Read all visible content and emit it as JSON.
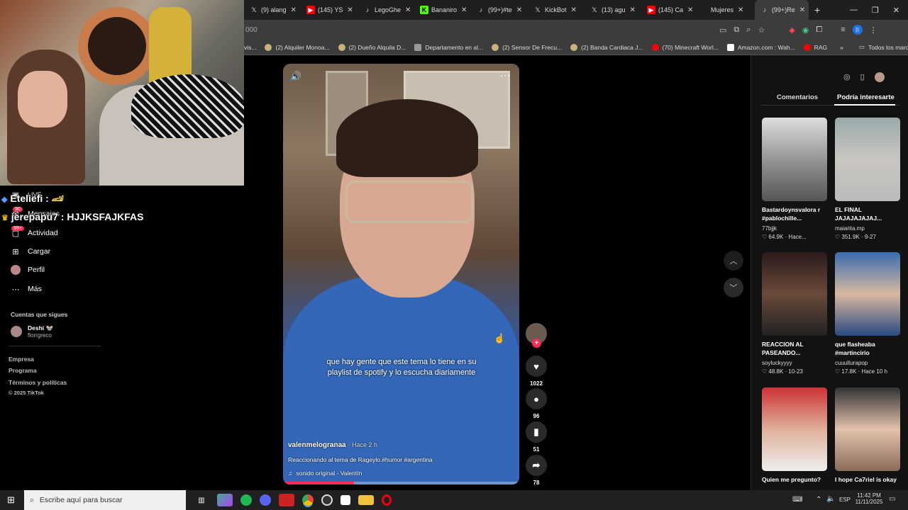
{
  "browser": {
    "tabs": [
      {
        "label": "(9) alang",
        "icon": "x-icon"
      },
      {
        "label": "(145) YS",
        "icon": "youtube-icon"
      },
      {
        "label": "LegoGhe",
        "icon": "tiktok-icon"
      },
      {
        "label": "Bananiro",
        "icon": "kick-icon"
      },
      {
        "label": "(99+)#te",
        "icon": "tiktok-icon"
      },
      {
        "label": "KickBot",
        "icon": "x-icon"
      },
      {
        "label": "(13) agu",
        "icon": "x-icon"
      },
      {
        "label": "(145) Ca",
        "icon": "youtube-icon"
      },
      {
        "label": "Mujeres",
        "icon": "none"
      },
      {
        "label": "(99+)Re",
        "icon": "tiktok-icon",
        "active": true
      }
    ],
    "new_tab": "+",
    "url": "000",
    "bookmarks": [
      "vis...",
      "(2) Alquiler Monoa...",
      "(2) Dueño Alquila D...",
      "Departamento en al...",
      "(2) Sensor De Frecu...",
      "(2) Banda Cardiaca J...",
      "(70) Minecraft Worl...",
      "Amazon.com : Wah...",
      "RAG"
    ],
    "all_bookmarks": "Todos los marcadores"
  },
  "stream_overlay": {
    "chat": [
      {
        "user": "Eteliefi",
        "text": ":"
      },
      {
        "user": "jerepapu7",
        "text": ": HJJKSFAJKFAS"
      }
    ],
    "badges": {
      "live": "LIVE",
      "messages_count": "90",
      "activity_count": "99+"
    }
  },
  "sidebar": {
    "items": [
      {
        "label": "Mensajes"
      },
      {
        "label": "Actividad"
      },
      {
        "label": "Cargar"
      },
      {
        "label": "Perfil"
      },
      {
        "label": "Más"
      }
    ],
    "following_title": "Cuentas que sigues",
    "following": {
      "name": "Deshi 🐭",
      "handle": "florrgreco"
    },
    "footer": [
      "Empresa",
      "Programa",
      "Términos y políticas",
      "© 2025 TikTok"
    ]
  },
  "video": {
    "caption": "que hay gente que este tema lo tiene en su playlist de spotify y lo escucha diariamente",
    "author": "valenmelogranaa",
    "time": "· Hace 2 h",
    "description": "Reaccionando al tema de Rageylo.#humor #argentina",
    "sound": "sonido original - Valentín",
    "actions": {
      "likes": "1022",
      "comments": "96",
      "saves": "51",
      "shares": "78"
    }
  },
  "right_panel": {
    "tabs": [
      "Comentarios",
      "Podría interesarte"
    ],
    "active_tab": 1,
    "cards": [
      {
        "title": "Bastardoynsvalora r #pablochille...",
        "author": "77bjjk",
        "likes": "64.9K",
        "time": "Hace..."
      },
      {
        "title": "EL FINAL JAJAJAJAJAJ...",
        "author": "maiarita.mp",
        "likes": "351.9K",
        "time": "9-27"
      },
      {
        "title": "REACCION AL PASEANDO...",
        "author": "soyluckyyyy",
        "likes": "48.8K",
        "time": "10-23"
      },
      {
        "title": "que flasheaba #martincirio",
        "author": "cuuulturapop",
        "likes": "17.8K",
        "time": "Hace 10 h"
      },
      {
        "title": "Quien me pregunto?",
        "author": "",
        "likes": "",
        "time": ""
      },
      {
        "title": "I hope Ca7riel is okay",
        "author": "",
        "likes": "",
        "time": ""
      }
    ]
  },
  "taskbar": {
    "search_placeholder": "Escribe aquí para buscar",
    "lang": "ESP",
    "time": "11:42 PM",
    "date": "11/11/2025"
  }
}
